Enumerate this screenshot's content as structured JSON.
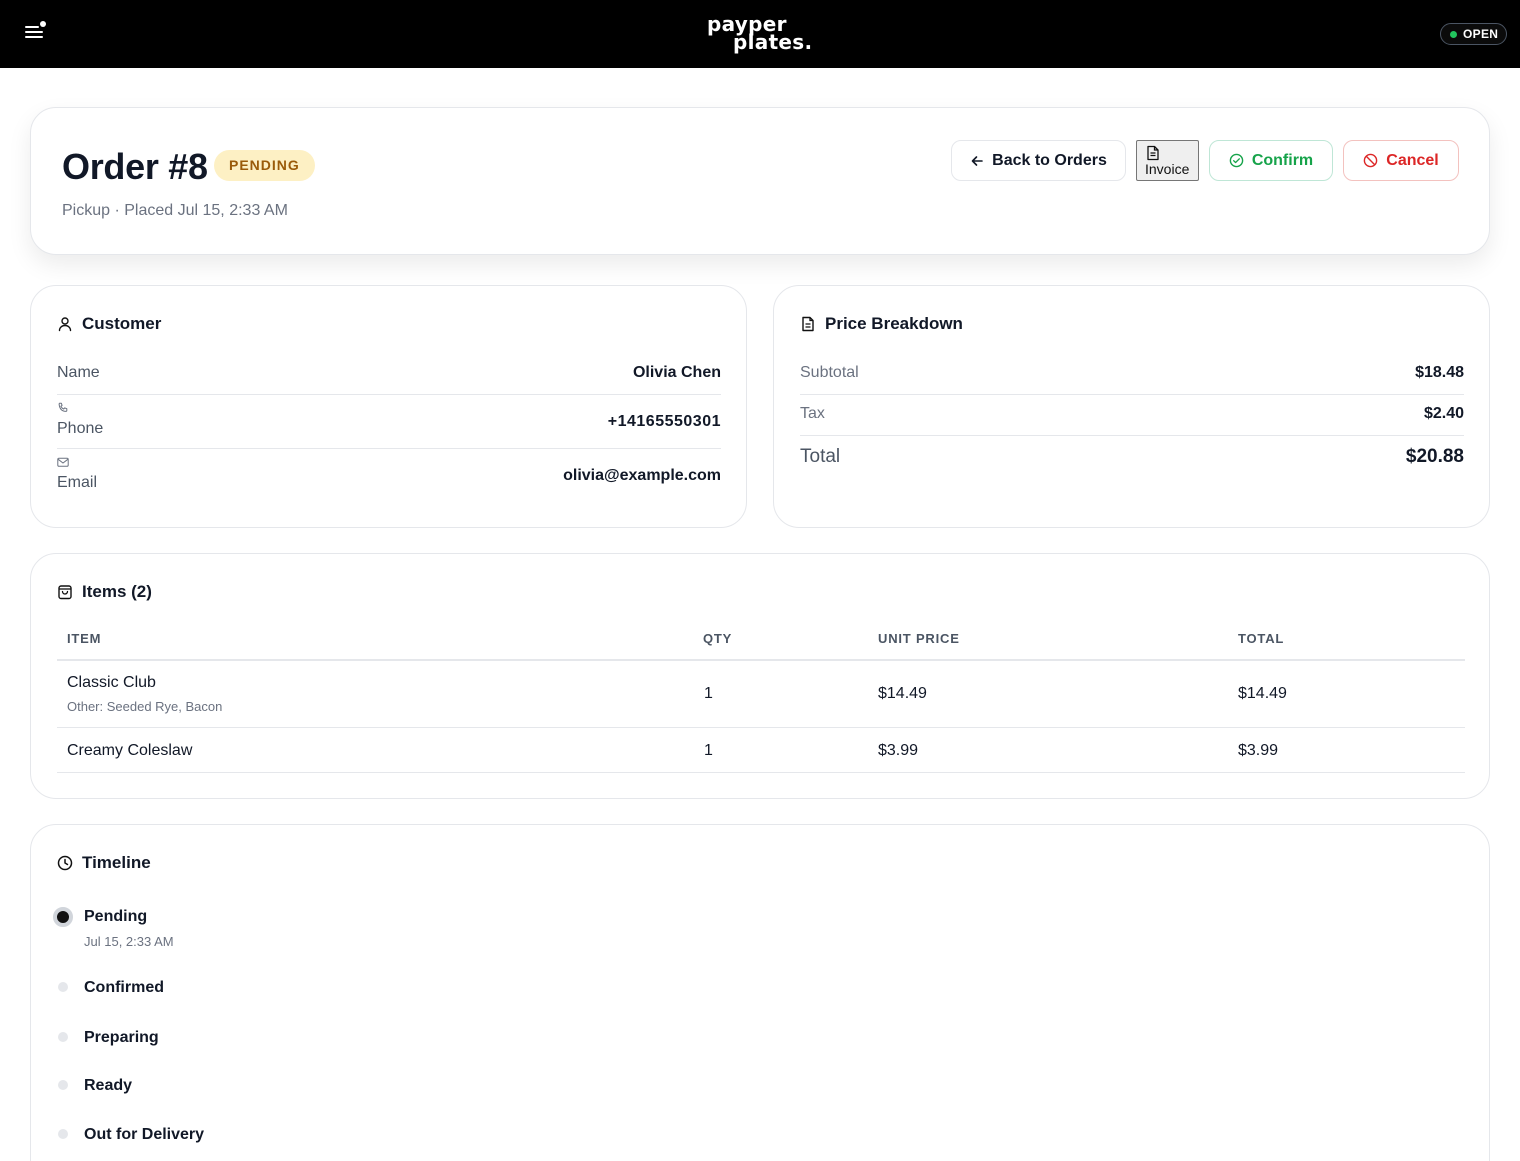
{
  "topbar": {
    "logo_line1": "payper",
    "logo_line2": "plates.",
    "status": "OPEN",
    "status_color": "#22c55e",
    "menu_icon": "hamburger-menu-icon"
  },
  "order": {
    "title": "Order #8",
    "status_badge": "PENDING",
    "subtitle": "Pickup · Placed Jul 15, 2:33 AM",
    "buttons": {
      "back": "Back to Orders",
      "invoice": "Invoice",
      "confirm": "Confirm",
      "cancel": "Cancel"
    }
  },
  "customer": {
    "heading": "Customer",
    "name_label": "Name",
    "name": "Olivia Chen",
    "phone_label": "Phone",
    "phone": "+14165550301",
    "email_label": "Email",
    "email": "olivia@example.com"
  },
  "price": {
    "heading": "Price Breakdown",
    "subtotal_label": "Subtotal",
    "subtotal": "$18.48",
    "tax_label": "Tax",
    "tax": "$2.40",
    "total_label": "Total",
    "total": "$20.88"
  },
  "items": {
    "heading": "Items (2)",
    "columns": [
      "ITEM",
      "QTY",
      "UNIT PRICE",
      "TOTAL"
    ],
    "rows": [
      {
        "name": "Classic Club",
        "note": "Other: Seeded Rye, Bacon",
        "qty": "1",
        "unit_price": "$14.49",
        "total": "$14.49"
      },
      {
        "name": "Creamy Coleslaw",
        "note": "",
        "qty": "1",
        "unit_price": "$3.99",
        "total": "$3.99"
      }
    ]
  },
  "timeline": {
    "heading": "Timeline",
    "steps": [
      {
        "label": "Pending",
        "time": "Jul 15, 2:33 AM",
        "active": true
      },
      {
        "label": "Confirmed",
        "time": "",
        "active": false
      },
      {
        "label": "Preparing",
        "time": "",
        "active": false
      },
      {
        "label": "Ready",
        "time": "",
        "active": false
      },
      {
        "label": "Out for Delivery",
        "time": "",
        "active": false
      }
    ]
  },
  "colors": {
    "topbar_bg": "#000000",
    "pending_badge_bg": "#fdf0c4",
    "pending_badge_text": "#9a5b0a",
    "confirm": "#16a34a",
    "cancel": "#dc2626"
  }
}
